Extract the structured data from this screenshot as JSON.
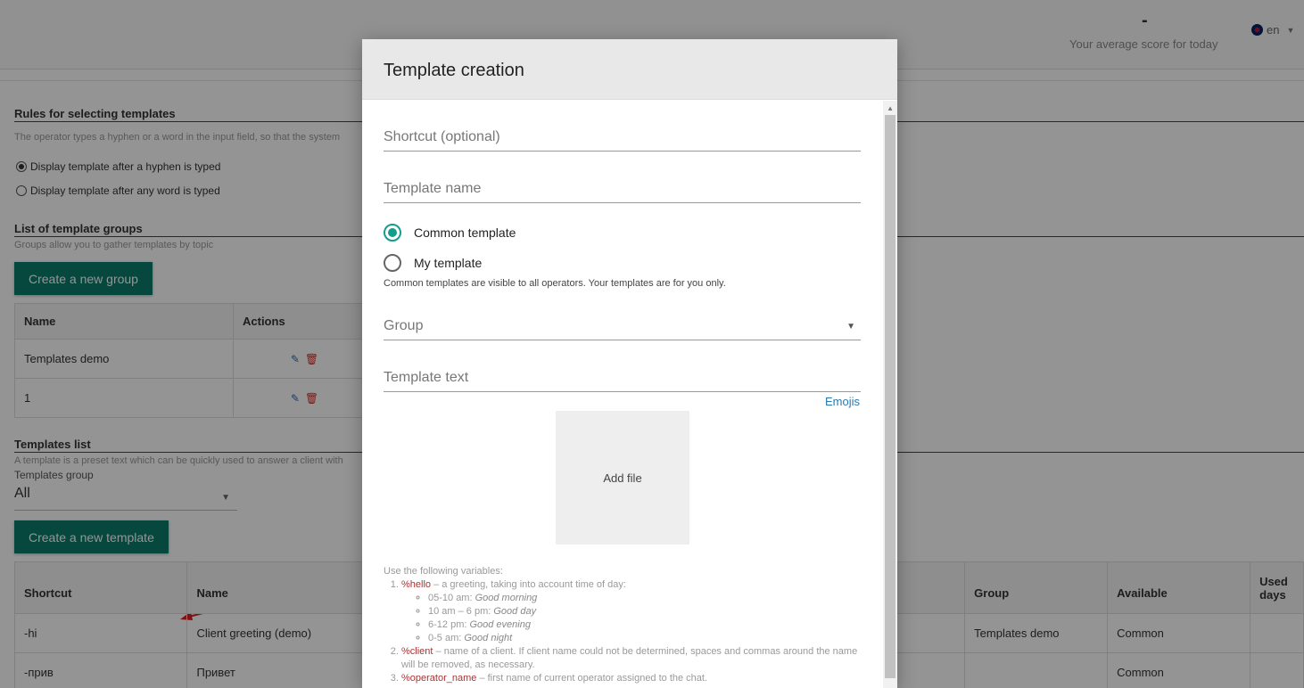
{
  "header": {
    "score_value": "-",
    "score_label": "Your average score for today",
    "language": "en"
  },
  "rules": {
    "title": "Rules for selecting templates",
    "desc": "The operator types a hyphen or a word in the input field, so that the system",
    "options": [
      {
        "label": "Display template after a hyphen is typed",
        "selected": true
      },
      {
        "label": "Display template after any word is typed",
        "selected": false
      }
    ]
  },
  "groups": {
    "title": "List of template groups",
    "desc": "Groups allow you to gather templates by topic",
    "create_label": "Create a new group",
    "columns": [
      "Name",
      "Actions"
    ],
    "rows": [
      {
        "name": "Templates demo"
      },
      {
        "name": "1"
      }
    ]
  },
  "templates": {
    "title": "Templates list",
    "desc": "A template is a preset text which can be quickly used to answer a client with",
    "group_label": "Templates group",
    "group_value": "All",
    "create_label": "Create a new template",
    "columns": [
      "Shortcut",
      "Name",
      "Group",
      "Available",
      "Used days"
    ],
    "rows": [
      {
        "shortcut": "-hi",
        "name": "Client greeting (demo)",
        "group": "Templates demo",
        "available": "Common"
      },
      {
        "shortcut": "-прив",
        "name": "Привет",
        "group": "",
        "available": "Common"
      }
    ]
  },
  "modal": {
    "title": "Template creation",
    "shortcut_placeholder": "Shortcut (optional)",
    "name_placeholder": "Template name",
    "options": [
      {
        "label": "Common template",
        "selected": true
      },
      {
        "label": "My template",
        "selected": false
      }
    ],
    "visibility_hint": "Common templates are visible to all operators. Your templates are for you only.",
    "group_placeholder": "Group",
    "text_placeholder": "Template text",
    "emojis_label": "Emojis",
    "add_file_label": "Add file",
    "vars_intro": "Use the following variables:",
    "var_hello_code": "%hello",
    "var_hello_desc": " – a greeting, taking into account time of day:",
    "hello_times": [
      {
        "range": "05-10 am: ",
        "greeting": "Good morning"
      },
      {
        "range": "10 am – 6 pm: ",
        "greeting": "Good day"
      },
      {
        "range": "6-12 pm: ",
        "greeting": "Good evening"
      },
      {
        "range": "0-5 am: ",
        "greeting": "Good night"
      }
    ],
    "var_client_code": "%client",
    "var_client_desc": " – name of a client. If client name could not be determined, spaces and commas around the name will be removed, as necessary.",
    "var_operator_code": "%operator_name",
    "var_operator_desc": " – first name of current operator assigned to the chat."
  },
  "colors": {
    "accent": "#0b7a6c",
    "radio_accent": "#149d8b",
    "danger": "#c9302c",
    "link": "#2a7ab0"
  }
}
